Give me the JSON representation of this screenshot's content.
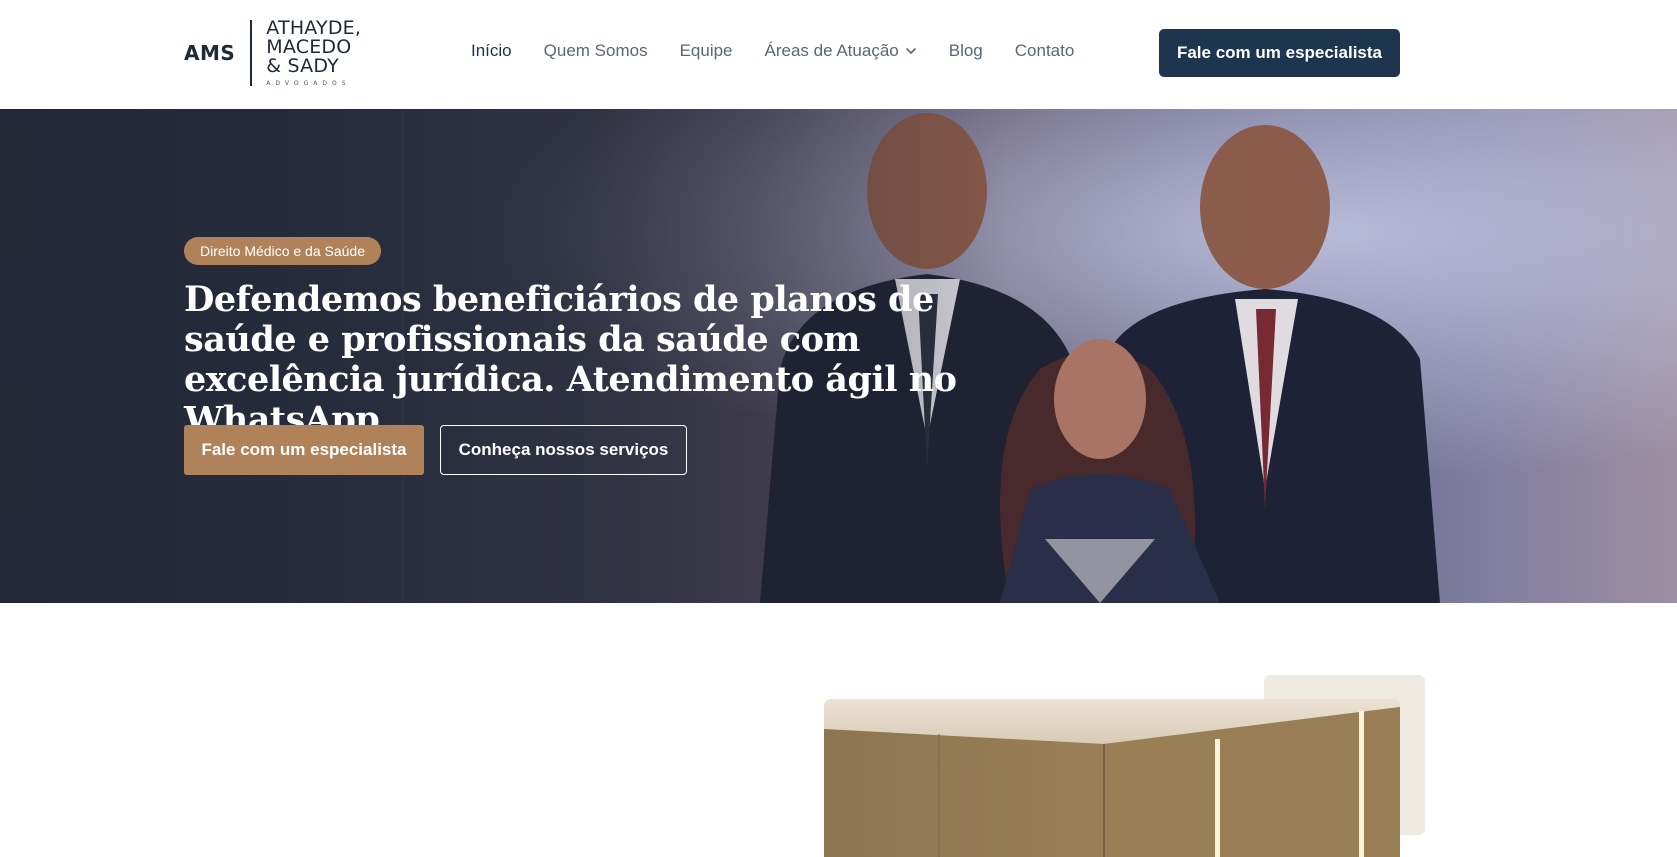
{
  "brand": {
    "mark": "AMS",
    "lines": [
      "ATHAYDE,",
      "MACEDO",
      "& SADY"
    ],
    "subtitle": "ADVOGADOS"
  },
  "nav": {
    "items": [
      {
        "label": "Início",
        "active": true
      },
      {
        "label": "Quem Somos"
      },
      {
        "label": "Equipe"
      },
      {
        "label": "Áreas de Atuação",
        "icon": "chevron-down-icon"
      },
      {
        "label": "Blog"
      },
      {
        "label": "Contato"
      }
    ]
  },
  "header": {
    "cta_label": "Fale com um especialista"
  },
  "hero": {
    "badge": "Direito Médico e da Saúde",
    "title": "Defendemos beneficiários de planos de saúde e profissionais da saúde com excelência jurídica. Atendimento ágil no WhatsApp.",
    "primary_cta": "Fale com um especialista",
    "secondary_cta": "Conheça nossos serviços"
  },
  "colors": {
    "navy": "#1e3550",
    "bronze": "#b0825a",
    "beige": "#efebe3"
  }
}
